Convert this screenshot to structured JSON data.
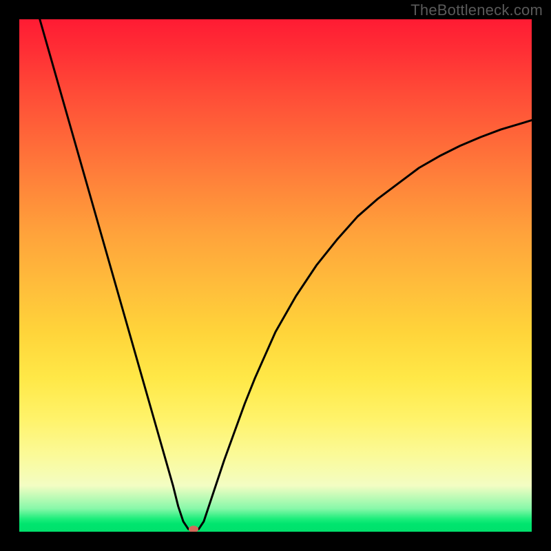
{
  "watermark": "TheBottleneck.com",
  "chart_data": {
    "type": "line",
    "title": "",
    "xlabel": "",
    "ylabel": "",
    "xlim": [
      0,
      100
    ],
    "ylim": [
      0,
      100
    ],
    "grid": false,
    "series": [
      {
        "name": "curve",
        "color": "#000000",
        "x": [
          4,
          6,
          8,
          10,
          12,
          14,
          16,
          18,
          20,
          22,
          24,
          26,
          28,
          30,
          31,
          32,
          33,
          34,
          35,
          36,
          38,
          40,
          42,
          44,
          46,
          48,
          50,
          54,
          58,
          62,
          66,
          70,
          74,
          78,
          82,
          86,
          90,
          94,
          100
        ],
        "y": [
          100,
          93,
          86,
          79,
          72,
          65,
          58,
          51,
          44,
          37,
          30,
          23,
          16,
          9,
          5,
          2,
          0.5,
          0.5,
          0.5,
          2,
          8,
          14,
          19.5,
          25,
          30,
          34.5,
          39,
          46,
          52,
          57,
          61.5,
          65,
          68,
          71,
          73.3,
          75.3,
          77,
          78.5,
          80.3
        ]
      }
    ],
    "marker": {
      "x": 34,
      "y": 0.5,
      "color": "#d46a5a",
      "rx": 7,
      "ry": 5
    },
    "background_gradient": {
      "stops": [
        {
          "offset": 0.0,
          "color": "#ff1b33"
        },
        {
          "offset": 0.5,
          "color": "#ffbd3b"
        },
        {
          "offset": 0.85,
          "color": "#fbfa98"
        },
        {
          "offset": 0.97,
          "color": "#1ced7b"
        },
        {
          "offset": 1.0,
          "color": "#01e06c"
        }
      ]
    }
  }
}
